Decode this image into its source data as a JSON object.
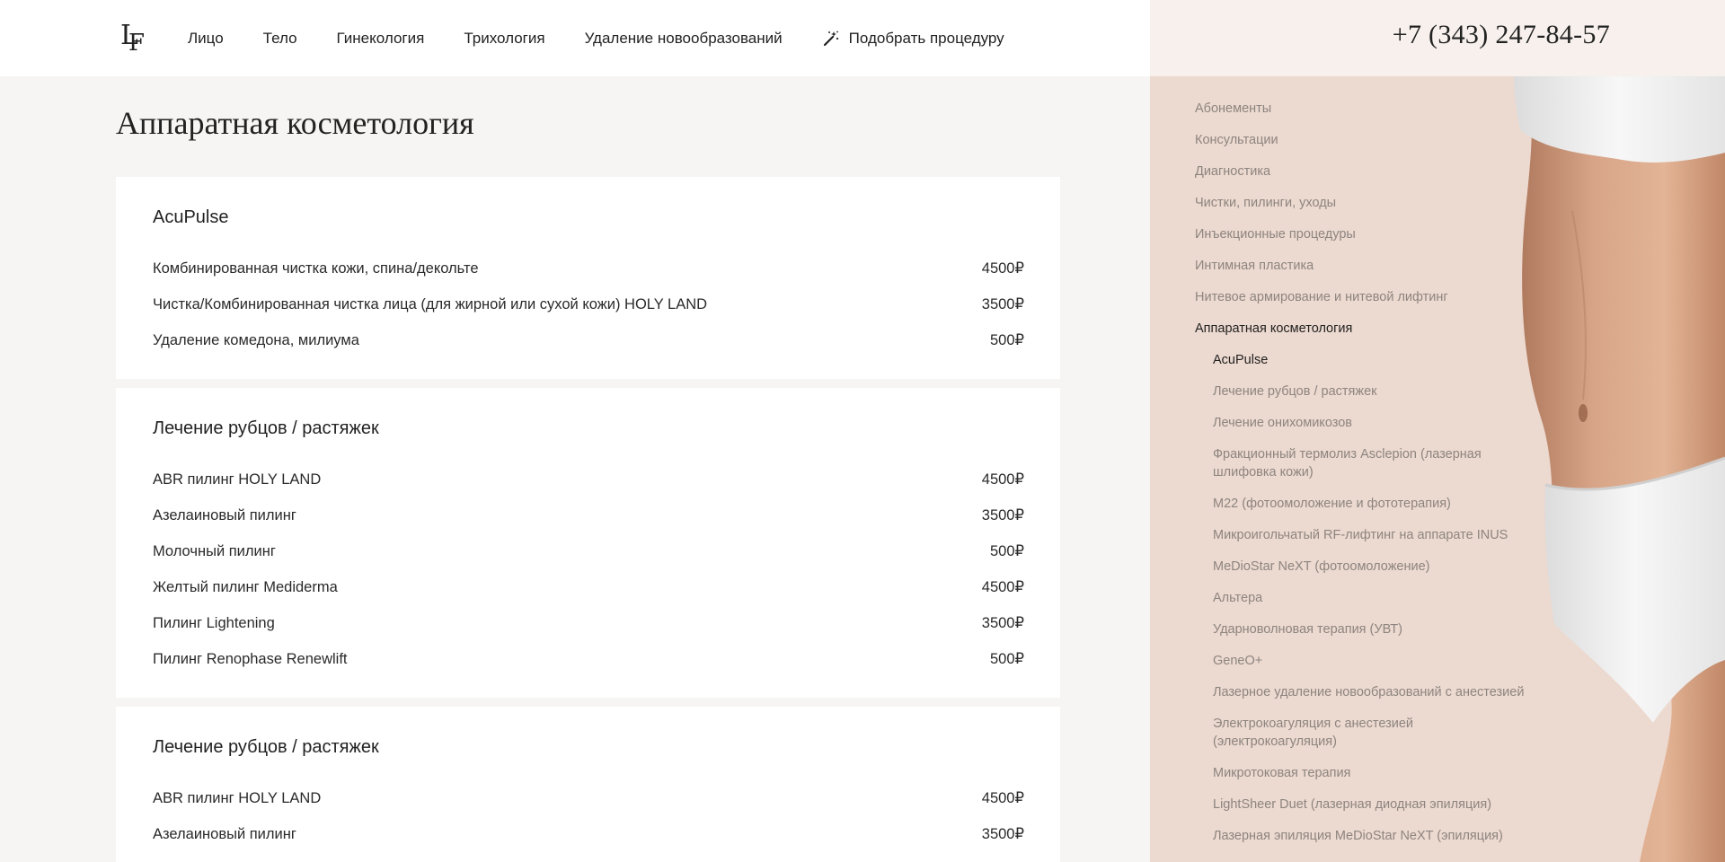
{
  "header": {
    "logo_text": "LF",
    "nav": [
      "Лицо",
      "Тело",
      "Гинекология",
      "Трихология",
      "Удаление новообразований"
    ],
    "pick_procedure": "Подобрать процедуру",
    "phone": "+7 (343) 247-84-57"
  },
  "page_title": "Аппаратная косметология",
  "cards": [
    {
      "title": "AcuPulse",
      "rows": [
        {
          "name": "Комбинированная чистка кожи, спина/декольте",
          "price": "4500₽"
        },
        {
          "name": "Чистка/Комбинированная чистка лица (для жирной или сухой кожи) HOLY LAND",
          "price": "3500₽"
        },
        {
          "name": "Удаление комедона, милиума",
          "price": "500₽"
        }
      ]
    },
    {
      "title": "Лечение рубцов / растяжек",
      "rows": [
        {
          "name": "ABR пилинг HOLY LAND",
          "price": "4500₽"
        },
        {
          "name": "Азелаиновый пилинг",
          "price": "3500₽"
        },
        {
          "name": "Молочный пилинг",
          "price": "500₽"
        },
        {
          "name": "Желтый пилинг Mediderma",
          "price": "4500₽"
        },
        {
          "name": "Пилинг Lightening",
          "price": "3500₽"
        },
        {
          "name": "Пилинг Renophase Renewlift",
          "price": "500₽"
        }
      ]
    },
    {
      "title": "Лечение рубцов / растяжек",
      "rows": [
        {
          "name": "ABR пилинг HOLY LAND",
          "price": "4500₽"
        },
        {
          "name": "Азелаиновый пилинг",
          "price": "3500₽"
        }
      ]
    }
  ],
  "sidebar": {
    "categories": [
      "Абонементы",
      "Консультации",
      "Диагностика",
      "Чистки, пилинги, уходы",
      "Инъекционные процедуры",
      "Интимная пластика",
      "Нитевое армирование и нитевой лифтинг",
      "Аппаратная косметология"
    ],
    "subitems": [
      "AcuPulse",
      "Лечение рубцов / растяжек",
      "Лечение онихомикозов",
      "Фракционный термолиз Asclepion (лазерная шлифовка кожи)",
      "M22 (фотоомоложение и фототерапия)",
      "Микроигольчатый RF-лифтинг на аппарате INUS",
      "MeDioStar NeXT (фотоомоложение)",
      "Альтера",
      "Ударноволновая терапия (УВТ)",
      "GeneO+",
      "Лазерное удаление новообразований с анестезией",
      "Электрокоагуляция с анестезией (электрокоагуляция)",
      "Микротоковая терапия",
      "LightSheer Duet (лазерная диодная эпиляция)",
      "Лазерная эпиляция MeDioStar NeXT (эпиляция)"
    ],
    "active_category": "Аппаратная косметология",
    "active_subitem": "AcuPulse"
  },
  "colors": {
    "sidebar_bg": "#ecd9cf",
    "phone_bg": "#f7f0ec",
    "page_bg": "#f6f5f3",
    "muted_text": "#8d8580"
  }
}
